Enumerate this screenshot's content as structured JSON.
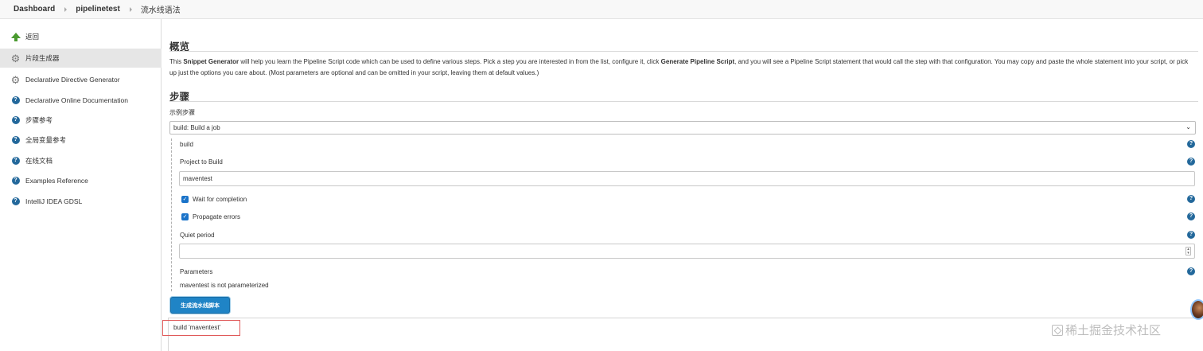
{
  "breadcrumb": {
    "items": [
      "Dashboard",
      "pipelinetest",
      "流水线语法"
    ]
  },
  "sidebar": {
    "items": [
      {
        "label": "返回",
        "icon": "up-arrow-icon"
      },
      {
        "label": "片段生成器",
        "icon": "gear-icon"
      },
      {
        "label": "Declarative Directive Generator",
        "icon": "gear-icon"
      },
      {
        "label": "Declarative Online Documentation",
        "icon": "help-icon"
      },
      {
        "label": "步骤参考",
        "icon": "help-icon"
      },
      {
        "label": "全局变量参考",
        "icon": "help-icon"
      },
      {
        "label": "在线文档",
        "icon": "help-icon"
      },
      {
        "label": "Examples Reference",
        "icon": "help-icon"
      },
      {
        "label": "IntelliJ IDEA GDSL",
        "icon": "help-icon"
      }
    ],
    "active_item": "片段生成器"
  },
  "overview": {
    "heading": "概览",
    "text_1": "This ",
    "bold_1": "Snippet Generator",
    "text_2": " will help you learn the Pipeline Script code which can be used to define various steps. Pick a step you are interested in from the list, configure it, click ",
    "bold_2": "Generate Pipeline Script",
    "text_3": ", and you will see a Pipeline Script statement that would call the step with that configuration. You may copy and paste the whole statement into your script, or pick up just the options you care about. (Most parameters are optional and can be omitted in your script, leaving them at default values.)"
  },
  "steps": {
    "heading": "步骤",
    "sample_step_label": "示例步骤",
    "selected_step": "build: Build a job",
    "step_name": "build",
    "project_label": "Project to Build",
    "project_value": "maventest",
    "wait_label": "Wait for completion",
    "wait_checked": "✓",
    "propagate_label": "Propagate errors",
    "propagate_checked": "✓",
    "quiet_label": "Quiet period",
    "quiet_value": "",
    "parameters_label": "Parameters",
    "parameters_note": "maventest is not parameterized",
    "generate_button": "生成流水线脚本"
  },
  "output": {
    "script": "build 'maventest'"
  },
  "watermark": "稀土掘金技术社区",
  "colors": {
    "accent": "#1f84c6",
    "help_icon": "#23689b",
    "checkbox": "#1a73c9",
    "highlight_box": "#e05a5a"
  }
}
